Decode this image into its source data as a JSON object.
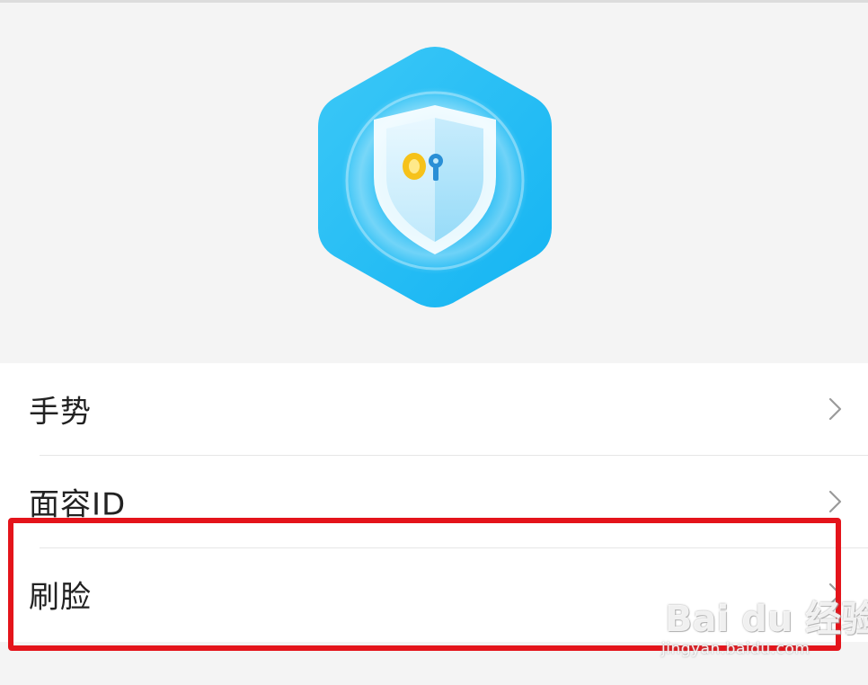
{
  "header": {
    "logo_icon": "security-shield-key-icon"
  },
  "menu": {
    "items": [
      {
        "label": "手势",
        "icon": "chevron-right-icon"
      },
      {
        "label": "面容ID",
        "icon": "chevron-right-icon"
      },
      {
        "label": "刷脸",
        "icon": "chevron-right-icon"
      }
    ]
  },
  "watermark": {
    "brand": "Bai du 经验",
    "url": "jingyan.baidu.com"
  },
  "colors": {
    "accent_blue": "#1ec2f5",
    "highlight_red": "#e4141b",
    "key_yellow": "#f6c21a"
  }
}
